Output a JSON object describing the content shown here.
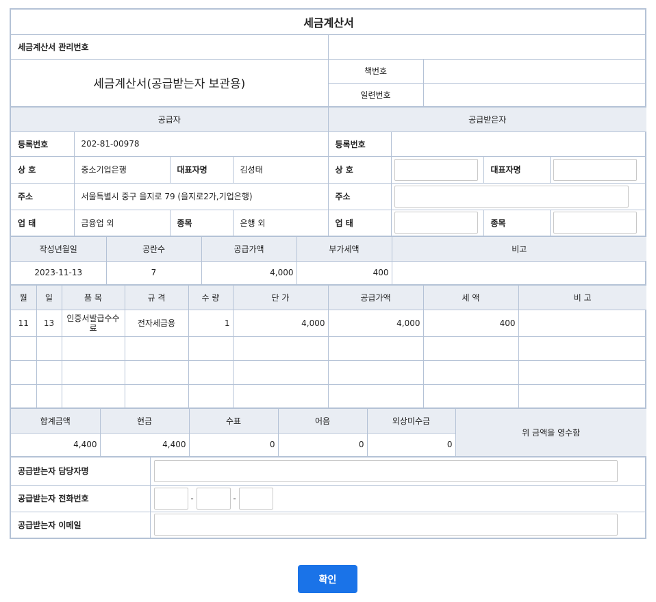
{
  "doc": {
    "title": "세금계산서",
    "mgmt_label": "세금계산서 관리번호",
    "mgmt_value": "",
    "subtitle": "세금계산서(공급받는자 보관용)",
    "book_label": "책번호",
    "book_value": "",
    "serial_label": "일련번호",
    "serial_value": ""
  },
  "supplier": {
    "heading": "공급자",
    "reg_label": "등록번호",
    "reg_value": "202-81-00978",
    "name_label": "상 호",
    "name_value": "중소기업은행",
    "rep_label": "대표자명",
    "rep_value": "김성태",
    "addr_label": "주소",
    "addr_value": "서울특별시 중구 을지로 79 (을지로2가,기업은행)",
    "biz_label": "업 태",
    "biz_value": "금융업 외",
    "item_label": "종목",
    "item_value": "은행 외"
  },
  "buyer": {
    "heading": "공급받은자",
    "reg_label": "등록번호",
    "reg_value": "",
    "name_label": "상 호",
    "rep_label": "대표자명",
    "addr_label": "주소",
    "biz_label": "업 태",
    "item_label": "종목"
  },
  "summary": {
    "headers": [
      "작성년월일",
      "공란수",
      "공급가액",
      "부가세액",
      "비고"
    ],
    "values": [
      "2023-11-13",
      "7",
      "4,000",
      "400",
      ""
    ]
  },
  "items": {
    "headers": [
      "월",
      "일",
      "품 목",
      "규 격",
      "수 량",
      "단 가",
      "공급가액",
      "세 액",
      "비 고"
    ],
    "rows": [
      [
        "11",
        "13",
        "인증서발급수수료",
        "전자세금용",
        "1",
        "4,000",
        "4,000",
        "400",
        ""
      ],
      [
        "",
        "",
        "",
        "",
        "",
        "",
        "",
        "",
        ""
      ],
      [
        "",
        "",
        "",
        "",
        "",
        "",
        "",
        "",
        ""
      ],
      [
        "",
        "",
        "",
        "",
        "",
        "",
        "",
        "",
        ""
      ]
    ]
  },
  "totals": {
    "headers": [
      "합계금액",
      "현금",
      "수표",
      "어음",
      "외상미수금"
    ],
    "values": [
      "4,400",
      "4,400",
      "0",
      "0",
      "0"
    ],
    "receipt": "위 금액을 영수함"
  },
  "contact": {
    "name_label": "공급받는자 담당자명",
    "phone_label": "공급받는자 전화번호",
    "phone_sep": "-",
    "email_label": "공급받는자 이메일"
  },
  "confirm_label": "확인",
  "colors": {
    "border": "#b4c2d6",
    "header_bg": "#e9edf3",
    "button": "#1a73e8"
  }
}
